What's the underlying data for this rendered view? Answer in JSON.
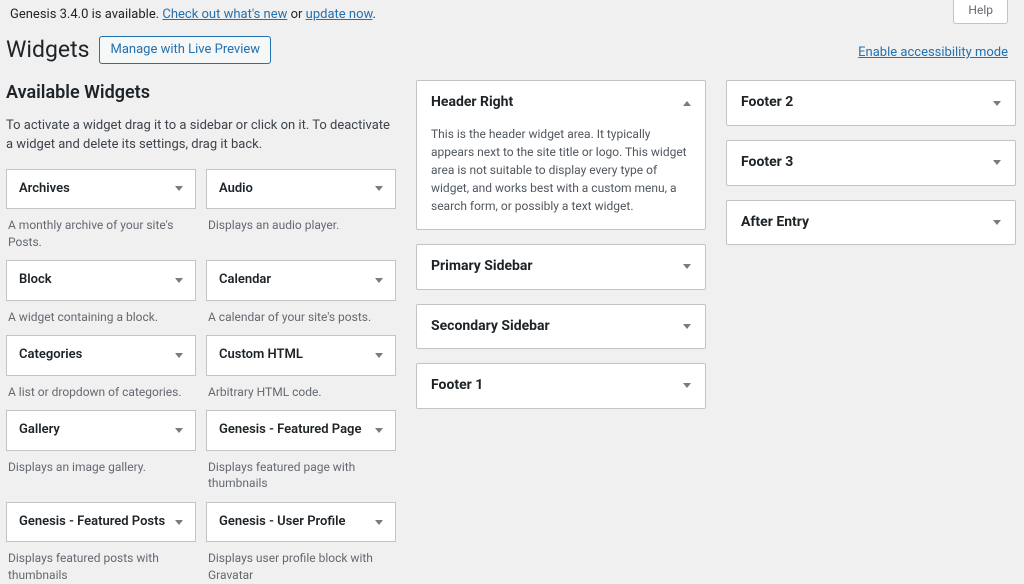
{
  "help": {
    "label": "Help"
  },
  "notice": {
    "prefix": "Genesis 3.4.0 is available. ",
    "whatsnew": "Check out what's new",
    "middle": " or ",
    "updatenow": "update now",
    "suffix": "."
  },
  "accessibility": {
    "label": "Enable accessibility mode"
  },
  "page_title": "Widgets",
  "live_preview": "Manage with Live Preview",
  "available": {
    "heading": "Available Widgets",
    "desc": "To activate a widget drag it to a sidebar or click on it. To deactivate a widget and delete its settings, drag it back.",
    "items": [
      {
        "title": "Archives",
        "desc": "A monthly archive of your site's Posts."
      },
      {
        "title": "Audio",
        "desc": "Displays an audio player."
      },
      {
        "title": "Block",
        "desc": "A widget containing a block."
      },
      {
        "title": "Calendar",
        "desc": "A calendar of your site's posts."
      },
      {
        "title": "Categories",
        "desc": "A list or dropdown of categories."
      },
      {
        "title": "Custom HTML",
        "desc": "Arbitrary HTML code."
      },
      {
        "title": "Gallery",
        "desc": "Displays an image gallery."
      },
      {
        "title": "Genesis - Featured Page",
        "desc": "Displays featured page with thumbnails"
      },
      {
        "title": "Genesis - Featured Posts",
        "desc": "Displays featured posts with thumbnails"
      },
      {
        "title": "Genesis - User Profile",
        "desc": "Displays user profile block with Gravatar"
      }
    ]
  },
  "areas_col1": [
    {
      "title": "Header Right",
      "expanded": true,
      "desc": "This is the header widget area. It typically appears next to the site title or logo. This widget area is not suitable to display every type of widget, and works best with a custom menu, a search form, or possibly a text widget."
    },
    {
      "title": "Primary Sidebar",
      "expanded": false
    },
    {
      "title": "Secondary Sidebar",
      "expanded": false
    },
    {
      "title": "Footer 1",
      "expanded": false
    }
  ],
  "areas_col2": [
    {
      "title": "Footer 2",
      "expanded": false
    },
    {
      "title": "Footer 3",
      "expanded": false
    },
    {
      "title": "After Entry",
      "expanded": false
    }
  ]
}
